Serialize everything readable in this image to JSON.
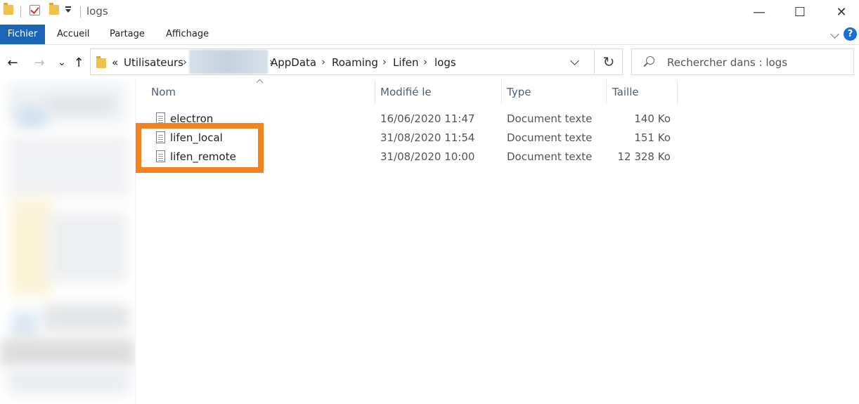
{
  "window": {
    "title": "logs",
    "minimize": "—",
    "maximize": "☐",
    "close": "✕"
  },
  "ribbon": {
    "tabs": [
      "Fichier",
      "Accueil",
      "Partage",
      "Affichage"
    ],
    "help": "?"
  },
  "nav": {
    "back": "←",
    "forward": "→",
    "recent": "⌄",
    "up": "↑"
  },
  "address": {
    "overflow": "«",
    "crumbs": [
      "Utilisateurs",
      "AppData",
      "Roaming",
      "Lifen",
      "logs"
    ],
    "separator": "›"
  },
  "search": {
    "placeholder": "Rechercher dans : logs"
  },
  "columns": {
    "name": "Nom",
    "modified": "Modifié le",
    "type": "Type",
    "size": "Taille"
  },
  "files": [
    {
      "name": "electron",
      "modified": "16/06/2020 11:47",
      "type": "Document texte",
      "size": "140 Ko"
    },
    {
      "name": "lifen_local",
      "modified": "31/08/2020 11:54",
      "type": "Document texte",
      "size": "151 Ko"
    },
    {
      "name": "lifen_remote",
      "modified": "31/08/2020 10:00",
      "type": "Document texte",
      "size": "12 328 Ko"
    }
  ],
  "colors": {
    "file_tab": "#1a65b8",
    "highlight": "#f58220",
    "header_text": "#4c607a"
  }
}
